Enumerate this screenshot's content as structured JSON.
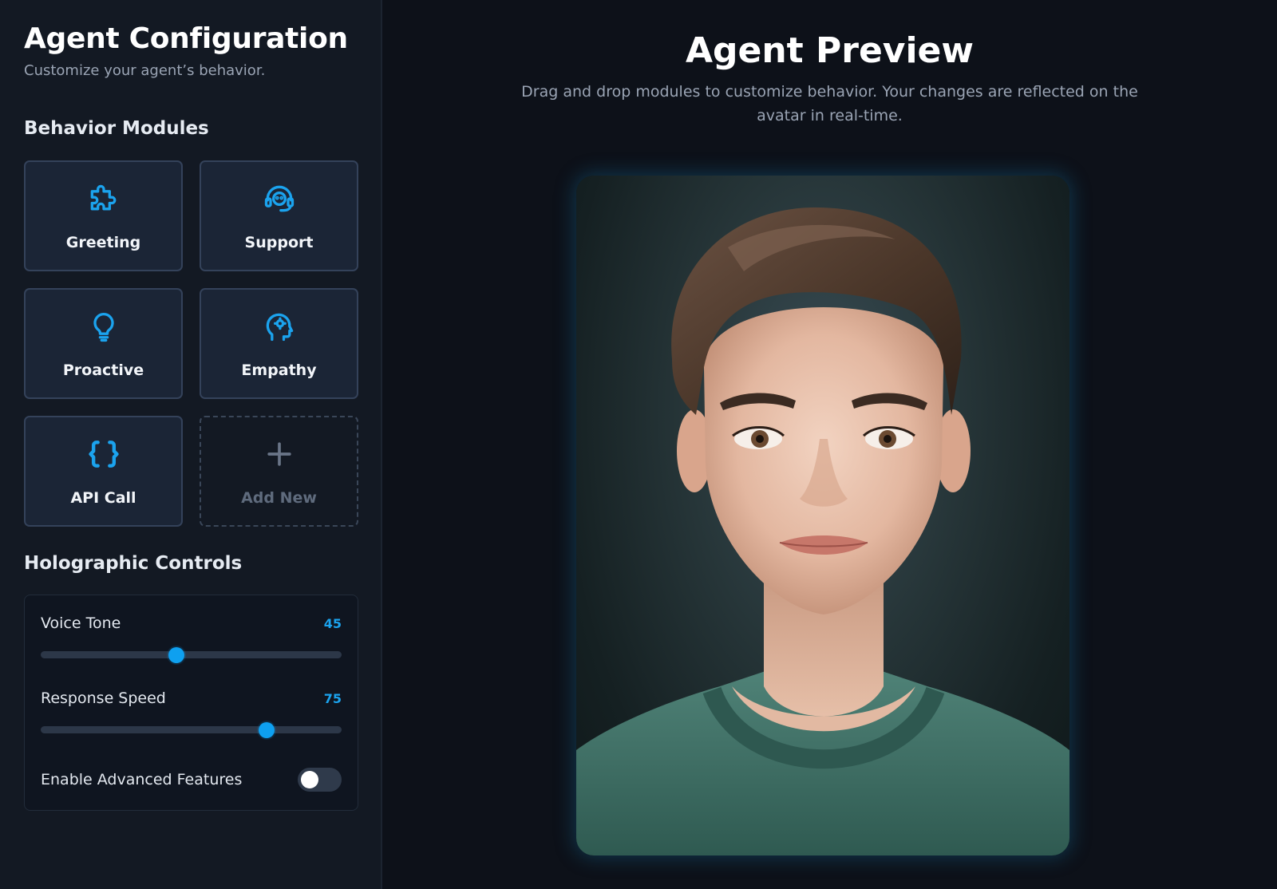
{
  "sidebar": {
    "title": "Agent Configuration",
    "subtitle": "Customize your agent’s behavior.",
    "modules_heading": "Behavior Modules",
    "modules": [
      {
        "label": "Greeting",
        "icon": "puzzle-icon"
      },
      {
        "label": "Support",
        "icon": "headset-icon"
      },
      {
        "label": "Proactive",
        "icon": "lightbulb-icon"
      },
      {
        "label": "Empathy",
        "icon": "brain-gear-icon"
      },
      {
        "label": "API Call",
        "icon": "curly-braces-icon"
      },
      {
        "label": "Add New",
        "icon": "plus-icon"
      }
    ],
    "controls_heading": "Holographic Controls",
    "controls": {
      "voice_tone": {
        "label": "Voice Tone",
        "value": "45",
        "fraction": 0.45
      },
      "response_speed": {
        "label": "Response Speed",
        "value": "75",
        "fraction": 0.75
      },
      "advanced": {
        "label": "Enable Advanced Features",
        "enabled": false
      }
    }
  },
  "main": {
    "title": "Agent Preview",
    "description": "Drag and drop modules to customize behavior. Your changes are reflected on the avatar in real-time."
  },
  "colors": {
    "accent": "#0ea0f0",
    "sidebar_bg": "#131923",
    "main_bg": "#0d1119",
    "module_bg": "#1b2536",
    "module_border": "#34425a"
  }
}
